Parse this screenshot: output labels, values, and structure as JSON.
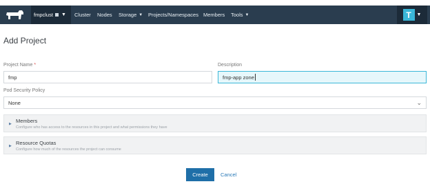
{
  "topbar": {
    "cluster_name": "fmpclust",
    "nav_items": [
      "Cluster",
      "Nodes",
      "Storage",
      "Projects/Namespaces",
      "Members",
      "Tools"
    ],
    "avatar_letter": "T"
  },
  "page": {
    "title": "Add Project"
  },
  "form": {
    "project_name_label": "Project Name",
    "project_name_required": "*",
    "project_name_value": "fmp",
    "description_label": "Description",
    "description_value": "fmp-app zone",
    "psp_label": "Pod Security Policy",
    "psp_value": "None"
  },
  "sections": {
    "members_title": "Members",
    "members_desc": "Configure who has access to the resources in this project and what permissions they have",
    "quotas_title": "Resource Quotas",
    "quotas_desc": "Configure how much of the resources the project can consume"
  },
  "actions": {
    "create_label": "Create",
    "cancel_label": "Cancel"
  },
  "colors": {
    "topbar": "#2a3d4f",
    "accent": "#3ab7d8",
    "primary_button": "#1f6fa8"
  }
}
